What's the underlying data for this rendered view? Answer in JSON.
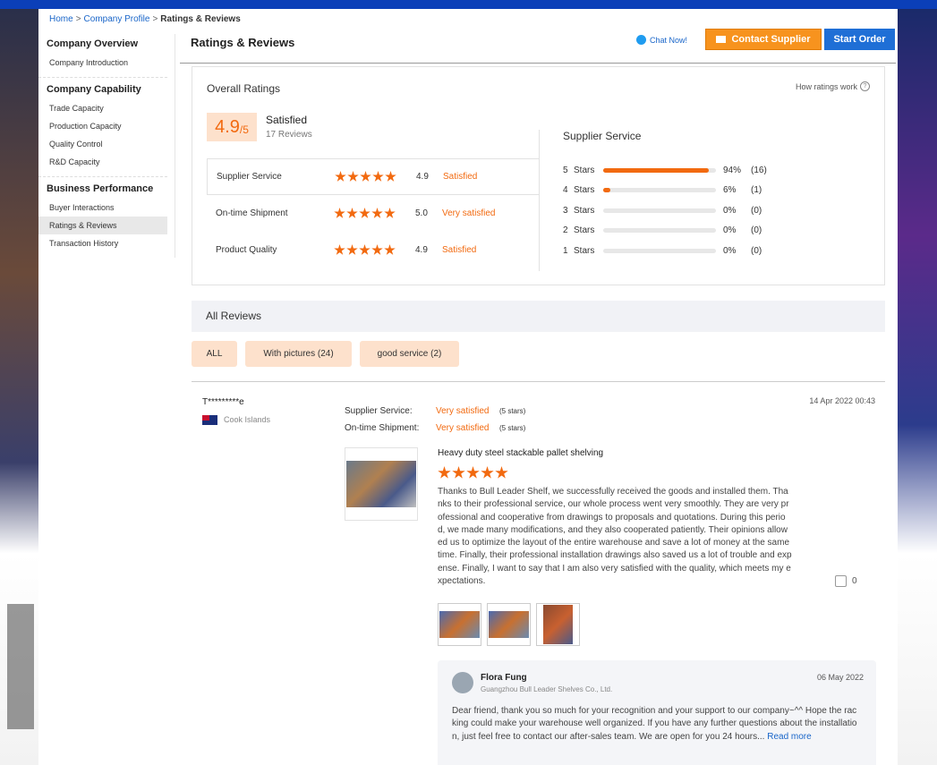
{
  "breadcrumb": {
    "home": "Home",
    "profile": "Company Profile",
    "current": "Ratings & Reviews",
    "separator": ">"
  },
  "sidebar": {
    "groups": [
      {
        "title": "Company Overview",
        "items": [
          "Company Introduction"
        ]
      },
      {
        "title": "Company Capability",
        "items": [
          "Trade Capacity",
          "Production Capacity",
          "Quality Control",
          "R&D Capacity"
        ]
      },
      {
        "title": "Business Performance",
        "items": [
          "Buyer Interactions",
          "Ratings & Reviews",
          "Transaction History"
        ]
      }
    ]
  },
  "header": {
    "title": "Ratings & Reviews",
    "chat_label": "Chat Now!",
    "contact_label": "Contact Supplier",
    "order_label": "Start Order"
  },
  "overall": {
    "title": "Overall Ratings",
    "how_label": "How ratings work",
    "score": "4.9",
    "denominator": "/5",
    "verdict": "Satisfied",
    "review_count": "17 Reviews",
    "rows": [
      {
        "name": "Supplier Service",
        "value": "4.9",
        "word": "Satisfied",
        "stars": 5
      },
      {
        "name": "On-time Shipment",
        "value": "5.0",
        "word": "Very satisfied",
        "stars": 5
      },
      {
        "name": "Product Quality",
        "value": "4.9",
        "word": "Satisfied",
        "stars": 5
      }
    ]
  },
  "distribution": {
    "title": "Supplier Service",
    "rows": [
      {
        "num": "5",
        "label": "Stars",
        "percent": 94,
        "pct_label": "94%",
        "count": "(16)"
      },
      {
        "num": "4",
        "label": "Stars",
        "percent": 6,
        "pct_label": "6%",
        "count": "(1)"
      },
      {
        "num": "3",
        "label": "Stars",
        "percent": 0,
        "pct_label": "0%",
        "count": "(0)"
      },
      {
        "num": "2",
        "label": "Stars",
        "percent": 0,
        "pct_label": "0%",
        "count": "(0)"
      },
      {
        "num": "1",
        "label": "Stars",
        "percent": 0,
        "pct_label": "0%",
        "count": "(0)"
      }
    ]
  },
  "all_reviews": {
    "title": "All Reviews",
    "filters": [
      "ALL",
      "With pictures (24)",
      "good service (2)"
    ]
  },
  "review": {
    "user": "T*********e",
    "country": "Cook Islands",
    "meta": [
      {
        "label": "Supplier Service:",
        "word": "Very satisfied",
        "stars": "(5 stars)"
      },
      {
        "label": "On-time Shipment:",
        "word": "Very satisfied",
        "stars": "(5 stars)"
      }
    ],
    "date": "14 Apr 2022 00:43",
    "product": "Heavy duty steel stackable pallet shelving",
    "rating": 5,
    "text": "Thanks to Bull Leader Shelf, we successfully received the goods and installed them. Thanks to their professional service, our whole process went very smoothly. They are very professional and cooperative from drawings to proposals and quotations. During this period, we made many modifications, and they also cooperated patiently. Their opinions allowed us to optimize the layout of the entire warehouse and save a lot of money at the same time. Finally, their professional installation drawings also saved us a lot of trouble and expense. Finally, I want to say that I am also very satisfied with the quality, which meets my expectations.",
    "likes": "0"
  },
  "reply": {
    "name": "Flora Fung",
    "company": "Guangzhou Bull Leader Shelves Co., Ltd.",
    "date": "06 May 2022",
    "text": "Dear friend, thank you so much for your recognition and your support to our company~^^ Hope the racking could make your warehouse well organized. If you have any further questions about the installation, just feel free to contact our after-sales team. We are open for you 24 hours...",
    "read_more": "Read more"
  },
  "colors": {
    "accent": "#f26a10",
    "brand_blue": "#1f6fd6",
    "chip": "#fde1cc"
  }
}
